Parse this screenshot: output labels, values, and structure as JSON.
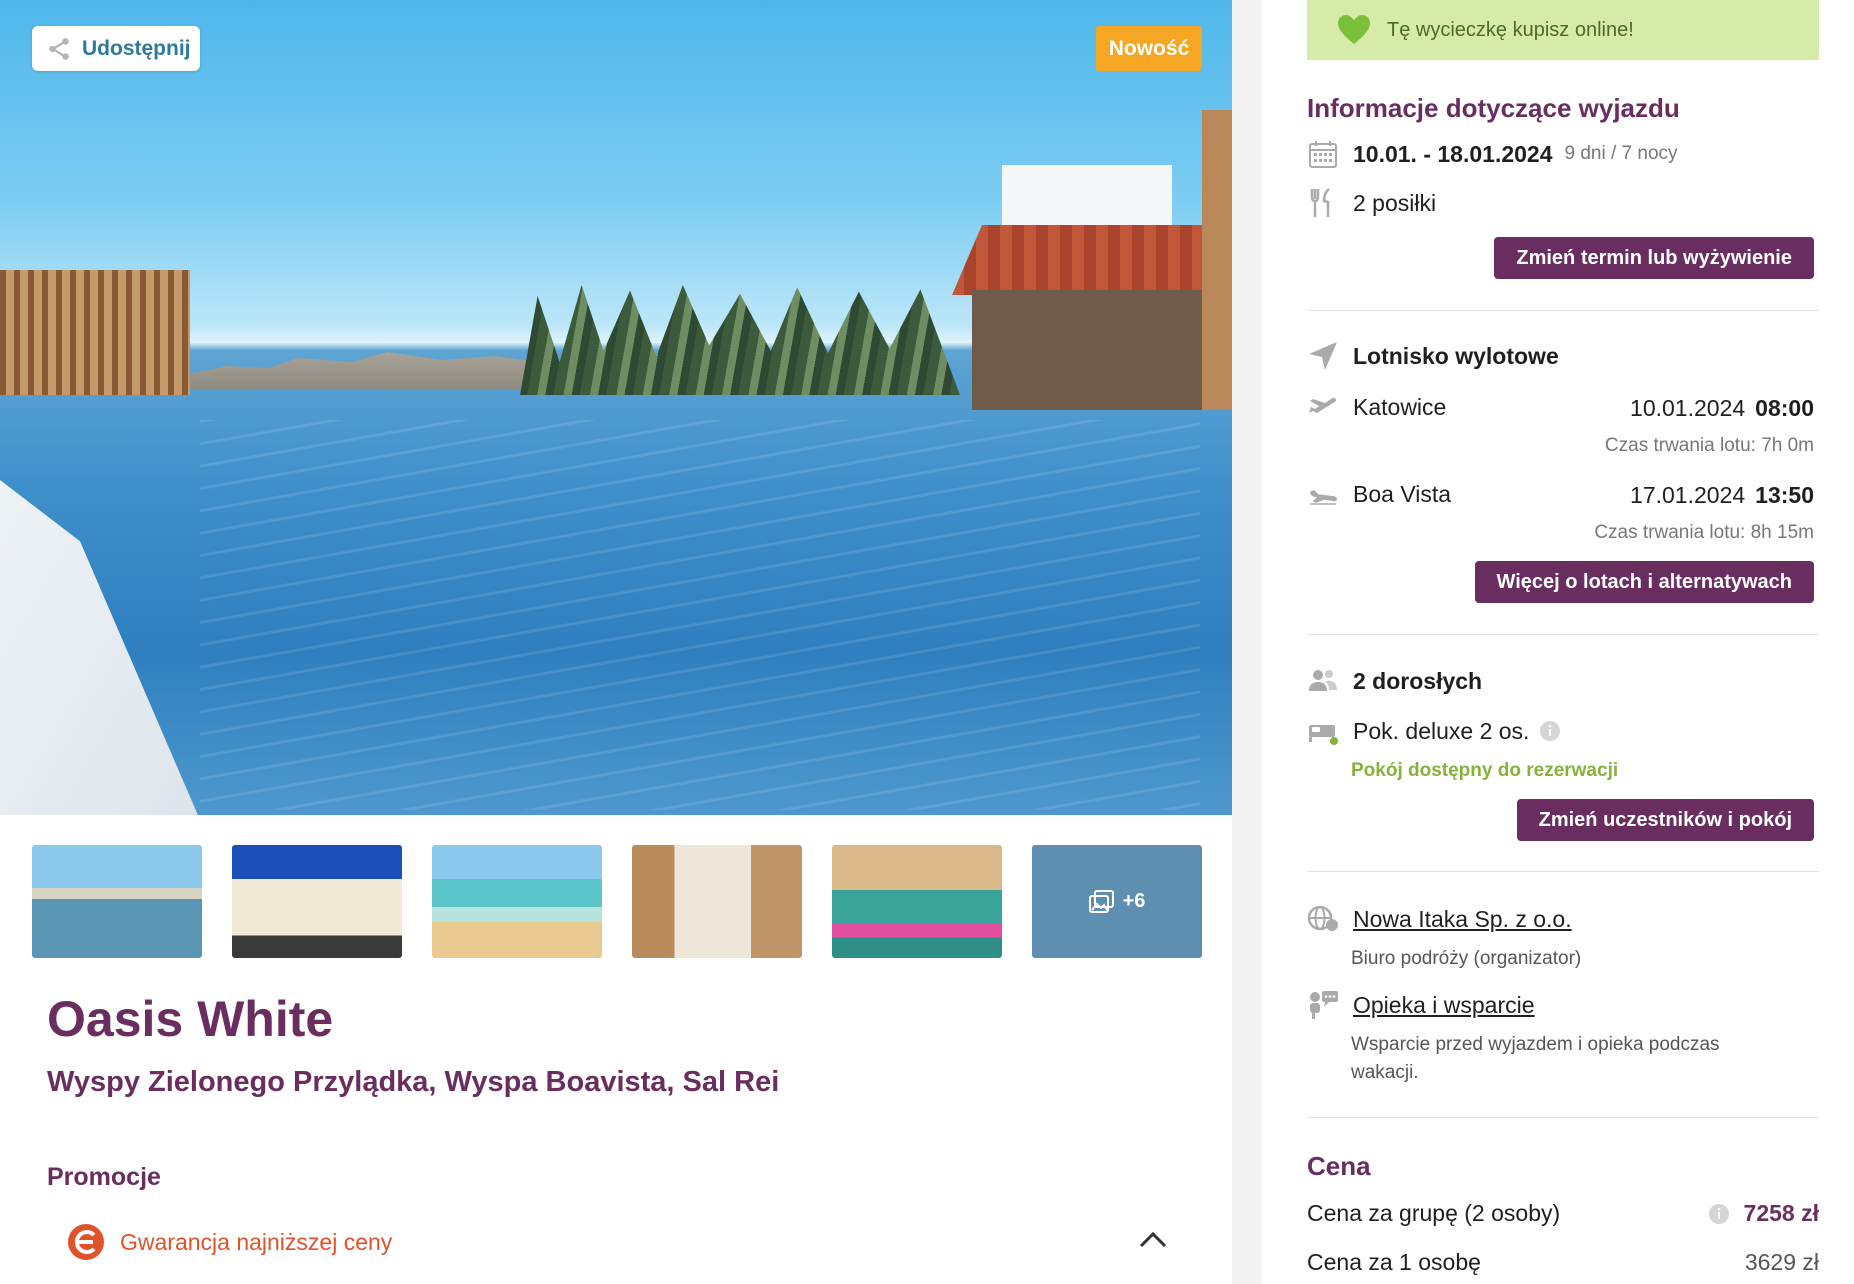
{
  "hero": {
    "share_label": "Udostępnij",
    "badge_new": "Nowość",
    "more_photos": "+6"
  },
  "hotel": {
    "name": "Oasis White",
    "location": "Wyspy Zielonego Przylądka, Wyspa Boavista, Sal Rei"
  },
  "promotions": {
    "title": "Promocje",
    "items": [
      "Gwarancja najniższej ceny"
    ]
  },
  "sidebar": {
    "online_banner": "Tę wycieczkę kupisz online!",
    "trip_info_title": "Informacje dotyczące wyjazdu",
    "dates": "10.01. - 18.01.2024",
    "duration": "9 dni / 7 nocy",
    "meals": "2 posiłki",
    "change_date_button": "Zmień termin lub wyżywienie",
    "airport_title": "Lotnisko wylotowe",
    "flights": [
      {
        "city": "Katowice",
        "date": "10.01.2024",
        "time": "08:00",
        "duration": "Czas trwania lotu: 7h 0m"
      },
      {
        "city": "Boa Vista",
        "date": "17.01.2024",
        "time": "13:50",
        "duration": "Czas trwania lotu: 8h 15m"
      }
    ],
    "more_flights_button": "Więcej o lotach i alternatywach",
    "participants": "2 dorosłych",
    "room": "Pok. deluxe 2 os.",
    "room_status": "Pokój dostępny do rezerwacji",
    "change_room_button": "Zmień uczestników i pokój",
    "organizer_link": "Nowa Itaka Sp. z o.o.",
    "organizer_desc": "Biuro podróży (organizator)",
    "support_link": "Opieka i wsparcie",
    "support_desc": "Wsparcie przed wyjazdem i opieka podczas wakacji.",
    "price_title": "Cena",
    "price_group_label": "Cena za grupę (2 osoby)",
    "price_group_value": "7258 zł",
    "price_person_label": "Cena za 1 osobę",
    "price_person_value": "3629 zł"
  },
  "colors": {
    "brand_purple": "#6a2d5f",
    "accent_orange": "#f5a623",
    "online_green_bg": "#d7eba8",
    "available_green": "#86b23b",
    "link_blue": "#2d7a9c",
    "promo_red": "#e0532a"
  }
}
